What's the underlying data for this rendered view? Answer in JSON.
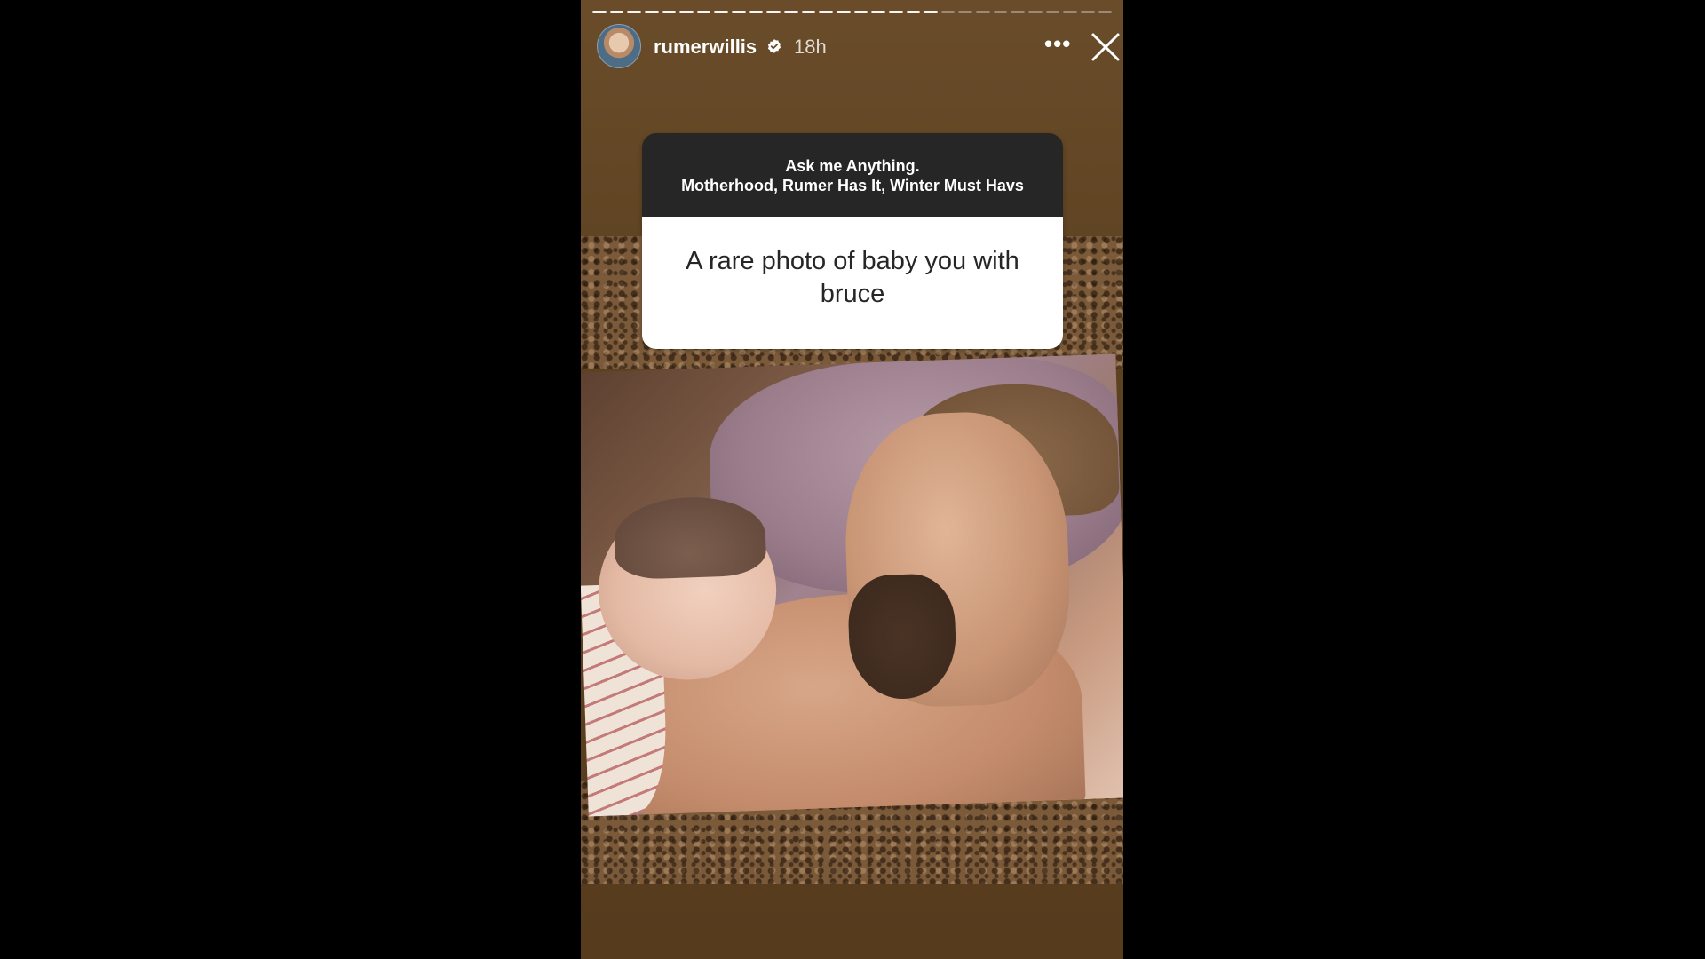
{
  "story": {
    "progress": {
      "total_segments": 30,
      "completed_segments": 20
    },
    "header": {
      "username": "rumerwillis",
      "verified_icon": "verified-badge-icon",
      "time_ago": "18h",
      "more_icon": "more-options-icon",
      "more_label": "•••",
      "close_icon": "close-icon"
    },
    "question_sticker": {
      "title": "Ask me Anything.",
      "topics": "Motherhood, Rumer Has It, Winter Must Havs",
      "question": "A rare photo of baby you with bruce"
    },
    "colors": {
      "background": "#5e4322",
      "sticker_header": "#262626",
      "sticker_body": "#ffffff"
    }
  }
}
